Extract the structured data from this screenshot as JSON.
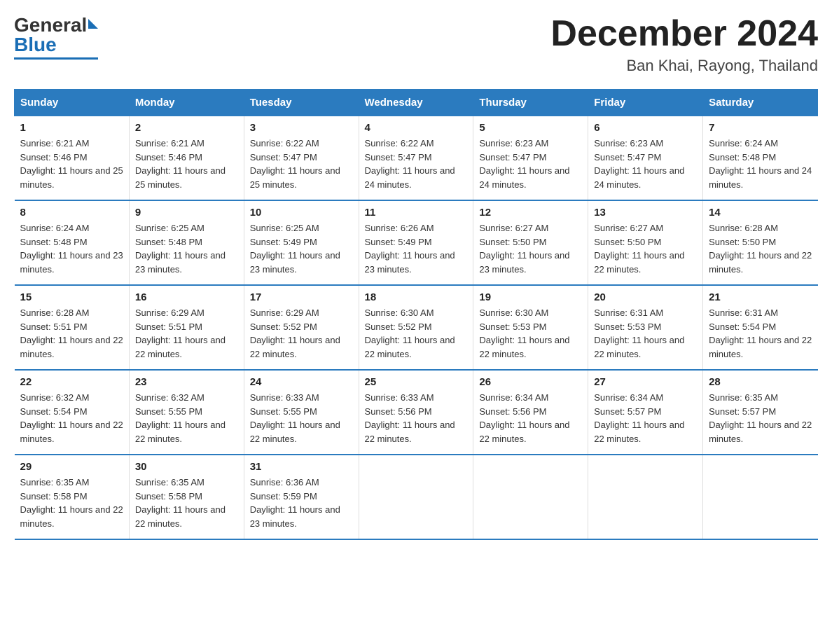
{
  "header": {
    "logo_general": "General",
    "logo_blue": "Blue",
    "month_title": "December 2024",
    "location": "Ban Khai, Rayong, Thailand"
  },
  "days_of_week": [
    "Sunday",
    "Monday",
    "Tuesday",
    "Wednesday",
    "Thursday",
    "Friday",
    "Saturday"
  ],
  "weeks": [
    [
      {
        "day": "1",
        "sunrise": "6:21 AM",
        "sunset": "5:46 PM",
        "daylight": "11 hours and 25 minutes."
      },
      {
        "day": "2",
        "sunrise": "6:21 AM",
        "sunset": "5:46 PM",
        "daylight": "11 hours and 25 minutes."
      },
      {
        "day": "3",
        "sunrise": "6:22 AM",
        "sunset": "5:47 PM",
        "daylight": "11 hours and 25 minutes."
      },
      {
        "day": "4",
        "sunrise": "6:22 AM",
        "sunset": "5:47 PM",
        "daylight": "11 hours and 24 minutes."
      },
      {
        "day": "5",
        "sunrise": "6:23 AM",
        "sunset": "5:47 PM",
        "daylight": "11 hours and 24 minutes."
      },
      {
        "day": "6",
        "sunrise": "6:23 AM",
        "sunset": "5:47 PM",
        "daylight": "11 hours and 24 minutes."
      },
      {
        "day": "7",
        "sunrise": "6:24 AM",
        "sunset": "5:48 PM",
        "daylight": "11 hours and 24 minutes."
      }
    ],
    [
      {
        "day": "8",
        "sunrise": "6:24 AM",
        "sunset": "5:48 PM",
        "daylight": "11 hours and 23 minutes."
      },
      {
        "day": "9",
        "sunrise": "6:25 AM",
        "sunset": "5:48 PM",
        "daylight": "11 hours and 23 minutes."
      },
      {
        "day": "10",
        "sunrise": "6:25 AM",
        "sunset": "5:49 PM",
        "daylight": "11 hours and 23 minutes."
      },
      {
        "day": "11",
        "sunrise": "6:26 AM",
        "sunset": "5:49 PM",
        "daylight": "11 hours and 23 minutes."
      },
      {
        "day": "12",
        "sunrise": "6:27 AM",
        "sunset": "5:50 PM",
        "daylight": "11 hours and 23 minutes."
      },
      {
        "day": "13",
        "sunrise": "6:27 AM",
        "sunset": "5:50 PM",
        "daylight": "11 hours and 22 minutes."
      },
      {
        "day": "14",
        "sunrise": "6:28 AM",
        "sunset": "5:50 PM",
        "daylight": "11 hours and 22 minutes."
      }
    ],
    [
      {
        "day": "15",
        "sunrise": "6:28 AM",
        "sunset": "5:51 PM",
        "daylight": "11 hours and 22 minutes."
      },
      {
        "day": "16",
        "sunrise": "6:29 AM",
        "sunset": "5:51 PM",
        "daylight": "11 hours and 22 minutes."
      },
      {
        "day": "17",
        "sunrise": "6:29 AM",
        "sunset": "5:52 PM",
        "daylight": "11 hours and 22 minutes."
      },
      {
        "day": "18",
        "sunrise": "6:30 AM",
        "sunset": "5:52 PM",
        "daylight": "11 hours and 22 minutes."
      },
      {
        "day": "19",
        "sunrise": "6:30 AM",
        "sunset": "5:53 PM",
        "daylight": "11 hours and 22 minutes."
      },
      {
        "day": "20",
        "sunrise": "6:31 AM",
        "sunset": "5:53 PM",
        "daylight": "11 hours and 22 minutes."
      },
      {
        "day": "21",
        "sunrise": "6:31 AM",
        "sunset": "5:54 PM",
        "daylight": "11 hours and 22 minutes."
      }
    ],
    [
      {
        "day": "22",
        "sunrise": "6:32 AM",
        "sunset": "5:54 PM",
        "daylight": "11 hours and 22 minutes."
      },
      {
        "day": "23",
        "sunrise": "6:32 AM",
        "sunset": "5:55 PM",
        "daylight": "11 hours and 22 minutes."
      },
      {
        "day": "24",
        "sunrise": "6:33 AM",
        "sunset": "5:55 PM",
        "daylight": "11 hours and 22 minutes."
      },
      {
        "day": "25",
        "sunrise": "6:33 AM",
        "sunset": "5:56 PM",
        "daylight": "11 hours and 22 minutes."
      },
      {
        "day": "26",
        "sunrise": "6:34 AM",
        "sunset": "5:56 PM",
        "daylight": "11 hours and 22 minutes."
      },
      {
        "day": "27",
        "sunrise": "6:34 AM",
        "sunset": "5:57 PM",
        "daylight": "11 hours and 22 minutes."
      },
      {
        "day": "28",
        "sunrise": "6:35 AM",
        "sunset": "5:57 PM",
        "daylight": "11 hours and 22 minutes."
      }
    ],
    [
      {
        "day": "29",
        "sunrise": "6:35 AM",
        "sunset": "5:58 PM",
        "daylight": "11 hours and 22 minutes."
      },
      {
        "day": "30",
        "sunrise": "6:35 AM",
        "sunset": "5:58 PM",
        "daylight": "11 hours and 22 minutes."
      },
      {
        "day": "31",
        "sunrise": "6:36 AM",
        "sunset": "5:59 PM",
        "daylight": "11 hours and 23 minutes."
      },
      null,
      null,
      null,
      null
    ]
  ],
  "labels": {
    "sunrise": "Sunrise:",
    "sunset": "Sunset:",
    "daylight": "Daylight:"
  }
}
